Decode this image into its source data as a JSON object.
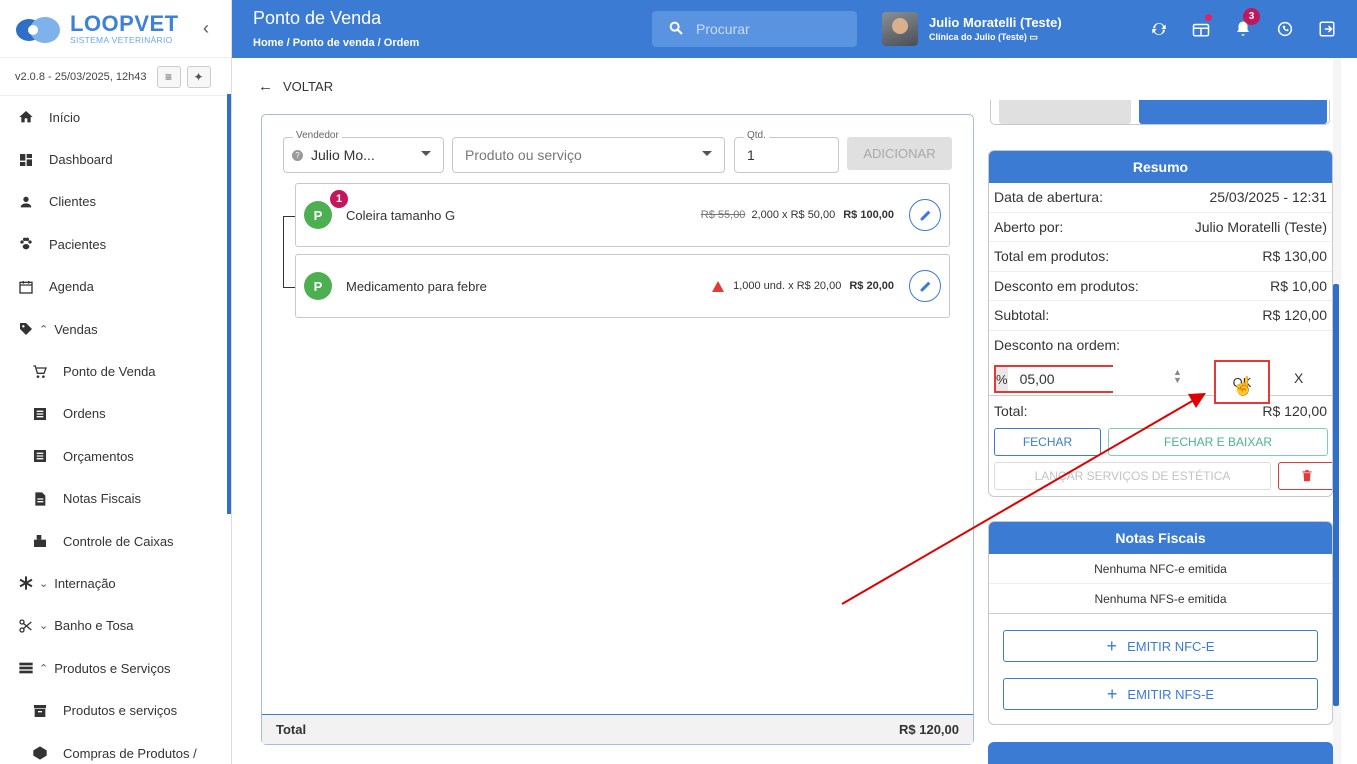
{
  "app": {
    "logo_name": "LOOPVET",
    "logo_sub": "SISTEMA VETERINÁRIO",
    "version": "v2.0.8 - 25/03/2025, 12h43"
  },
  "sidebar": {
    "items": [
      {
        "label": "Início",
        "icon": "home-icon"
      },
      {
        "label": "Dashboard",
        "icon": "dashboard-icon"
      },
      {
        "label": "Clientes",
        "icon": "person-icon"
      },
      {
        "label": "Pacientes",
        "icon": "paw-icon"
      },
      {
        "label": "Agenda",
        "icon": "calendar-icon"
      },
      {
        "label": "Vendas",
        "icon": "tag-icon",
        "expanded": true
      },
      {
        "label": "Ponto de Venda",
        "icon": "cart-icon",
        "sub": true
      },
      {
        "label": "Ordens",
        "icon": "list-icon",
        "sub": true
      },
      {
        "label": "Orçamentos",
        "icon": "list-icon",
        "sub": true
      },
      {
        "label": "Notas Fiscais",
        "icon": "document-icon",
        "sub": true
      },
      {
        "label": "Controle de Caixas",
        "icon": "cashbox-icon",
        "sub": true
      },
      {
        "label": "Internação",
        "icon": "asterisk-icon",
        "expanded": false
      },
      {
        "label": "Banho e Tosa",
        "icon": "scissors-icon",
        "expanded": false
      },
      {
        "label": "Produtos e Serviços",
        "icon": "stack-icon",
        "expanded": true
      },
      {
        "label": "Produtos e serviços",
        "icon": "archive-icon",
        "sub": true
      },
      {
        "label": "Compras de Produtos /",
        "icon": "box-icon",
        "sub": true
      }
    ]
  },
  "header": {
    "title": "Ponto de Venda",
    "breadcrumb": "Home  /  Ponto de venda  /  Ordem",
    "search_placeholder": "Procurar",
    "user_name": "Julio Moratelli (Teste)",
    "user_clinic": "Clínica do Julio (Teste)",
    "notification_count": "3"
  },
  "main": {
    "back_label": "VOLTAR",
    "vendedor_label": "Vendedor",
    "vendedor_value": "Julio Mo...",
    "produto_placeholder": "Produto ou serviço",
    "qtd_label": "Qtd.",
    "qtd_value": "1",
    "add_label": "ADICIONAR",
    "items": [
      {
        "type": "P",
        "badge": "1",
        "name": "Coleira tamanho G",
        "old_price": "R$ 55,00",
        "qty_price": "2,000 x R$ 50,00",
        "total": "R$ 100,00"
      },
      {
        "type": "P",
        "name": "Medicamento para febre",
        "qty_price": "1,000 und. x R$ 20,00",
        "total": "R$ 20,00",
        "warning": true
      }
    ],
    "total_label": "Total",
    "total_value": "R$ 120,00"
  },
  "resumo": {
    "title": "Resumo",
    "rows": [
      {
        "label": "Data de abertura:",
        "value": "25/03/2025 - 12:31"
      },
      {
        "label": "Aberto por:",
        "value": "Julio Moratelli (Teste)"
      },
      {
        "label": "Total em produtos:",
        "value": "R$ 130,00"
      },
      {
        "label": "Desconto em produtos:",
        "value": "R$ 10,00"
      },
      {
        "label": "Subtotal:",
        "value": "R$ 120,00"
      }
    ],
    "desconto_ordem_label": "Desconto na ordem:",
    "pct_label": "%",
    "pct_value": "05,00",
    "ok_label": "OK",
    "x_label": "X",
    "total_label": "Total:",
    "total_value": "R$ 120,00",
    "fechar_label": "FECHAR",
    "fechar_baixar_label": "FECHAR E BAIXAR",
    "lancar_label": "LANÇAR SERVIÇOS DE ESTÉTICA"
  },
  "notas": {
    "title": "Notas Fiscais",
    "nfce_status": "Nenhuma NFC-e emitida",
    "nfse_status": "Nenhuma NFS-e emitida",
    "emit_nfce": "EMITIR NFC-E",
    "emit_nfse": "EMITIR NFS-E"
  },
  "colors": {
    "primary": "#3b7bd4",
    "danger": "#e53935",
    "success": "#4caf50",
    "badge": "#c2185b",
    "annotation": "#e00000"
  }
}
